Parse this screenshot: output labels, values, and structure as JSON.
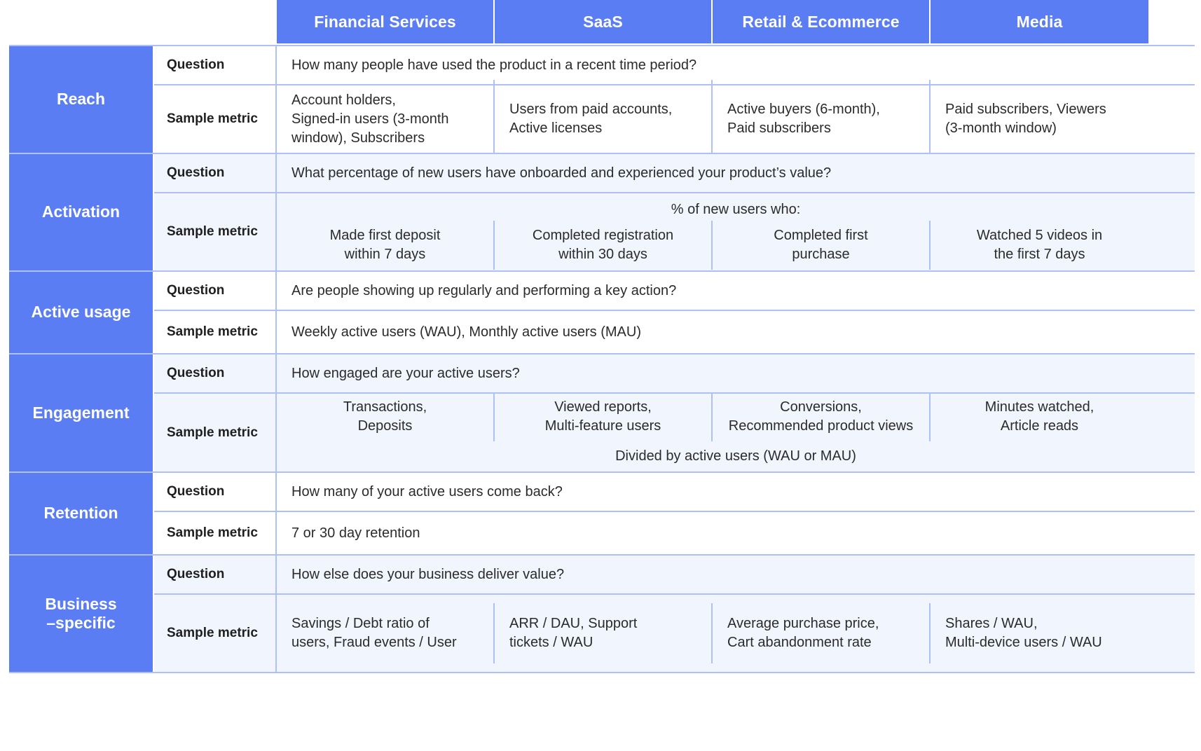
{
  "colors": {
    "accent": "#5a7df4",
    "tint": "#f1f5fe",
    "gridline": "#aec0f5",
    "text": "#2b2b2b",
    "header_text": "#ffffff"
  },
  "columns": [
    {
      "label": "Financial Services"
    },
    {
      "label": "SaaS"
    },
    {
      "label": "Retail & Ecommerce"
    },
    {
      "label": "Media"
    }
  ],
  "row_labels": {
    "question": "Question",
    "sample_metric": "Sample metric"
  },
  "bands": [
    {
      "category": [
        "Reach"
      ],
      "tone": "plain",
      "question": "How many people have used the product in a recent time period?",
      "metric_mode": "per-column",
      "metric_align": "left",
      "metrics": [
        "Account holders,\nSigned-in users (3-month window), Subscribers",
        "Users from paid accounts,\nActive licenses",
        "Active buyers (6-month),\nPaid subscribers",
        "Paid subscribers, Viewers\n(3-month window)"
      ]
    },
    {
      "category": [
        "Activation"
      ],
      "tone": "tint",
      "question": "What percentage of new users have onboarded and experienced your product’s value?",
      "metric_mode": "per-column",
      "metric_align": "center",
      "subhead": "% of new users who:",
      "metrics": [
        "Made first deposit\nwithin 7 days",
        "Completed registration\nwithin 30 days",
        "Completed first\npurchase",
        "Watched 5 videos in\nthe first 7 days"
      ]
    },
    {
      "category": [
        "Active usage"
      ],
      "tone": "plain",
      "question": "Are people showing up regularly and performing a key action?",
      "metric_mode": "full-width",
      "metric_text": "Weekly active users (WAU), Monthly active users (MAU)"
    },
    {
      "category": [
        "Engagement"
      ],
      "tone": "tint",
      "question": "How engaged are your active users?",
      "metric_mode": "per-column",
      "metric_align": "center",
      "footnote": "Divided by active users (WAU or MAU)",
      "metrics": [
        "Transactions,\nDeposits",
        "Viewed reports,\nMulti-feature users",
        "Conversions,\nRecommended product views",
        "Minutes watched,\nArticle reads"
      ]
    },
    {
      "category": [
        "Retention"
      ],
      "tone": "plain",
      "question": "How many of your active users come back?",
      "metric_mode": "full-width",
      "metric_text": "7 or 30 day retention"
    },
    {
      "category": [
        "Business",
        "–specific"
      ],
      "tone": "tint",
      "question": "How else does your business deliver value?",
      "metric_mode": "per-column",
      "metric_align": "left",
      "metrics": [
        "Savings / Debt ratio of\nusers, Fraud events  / User",
        "ARR / DAU, Support\ntickets / WAU",
        "Average purchase price,\nCart abandonment rate",
        "Shares / WAU,\nMulti-device users / WAU"
      ]
    }
  ]
}
